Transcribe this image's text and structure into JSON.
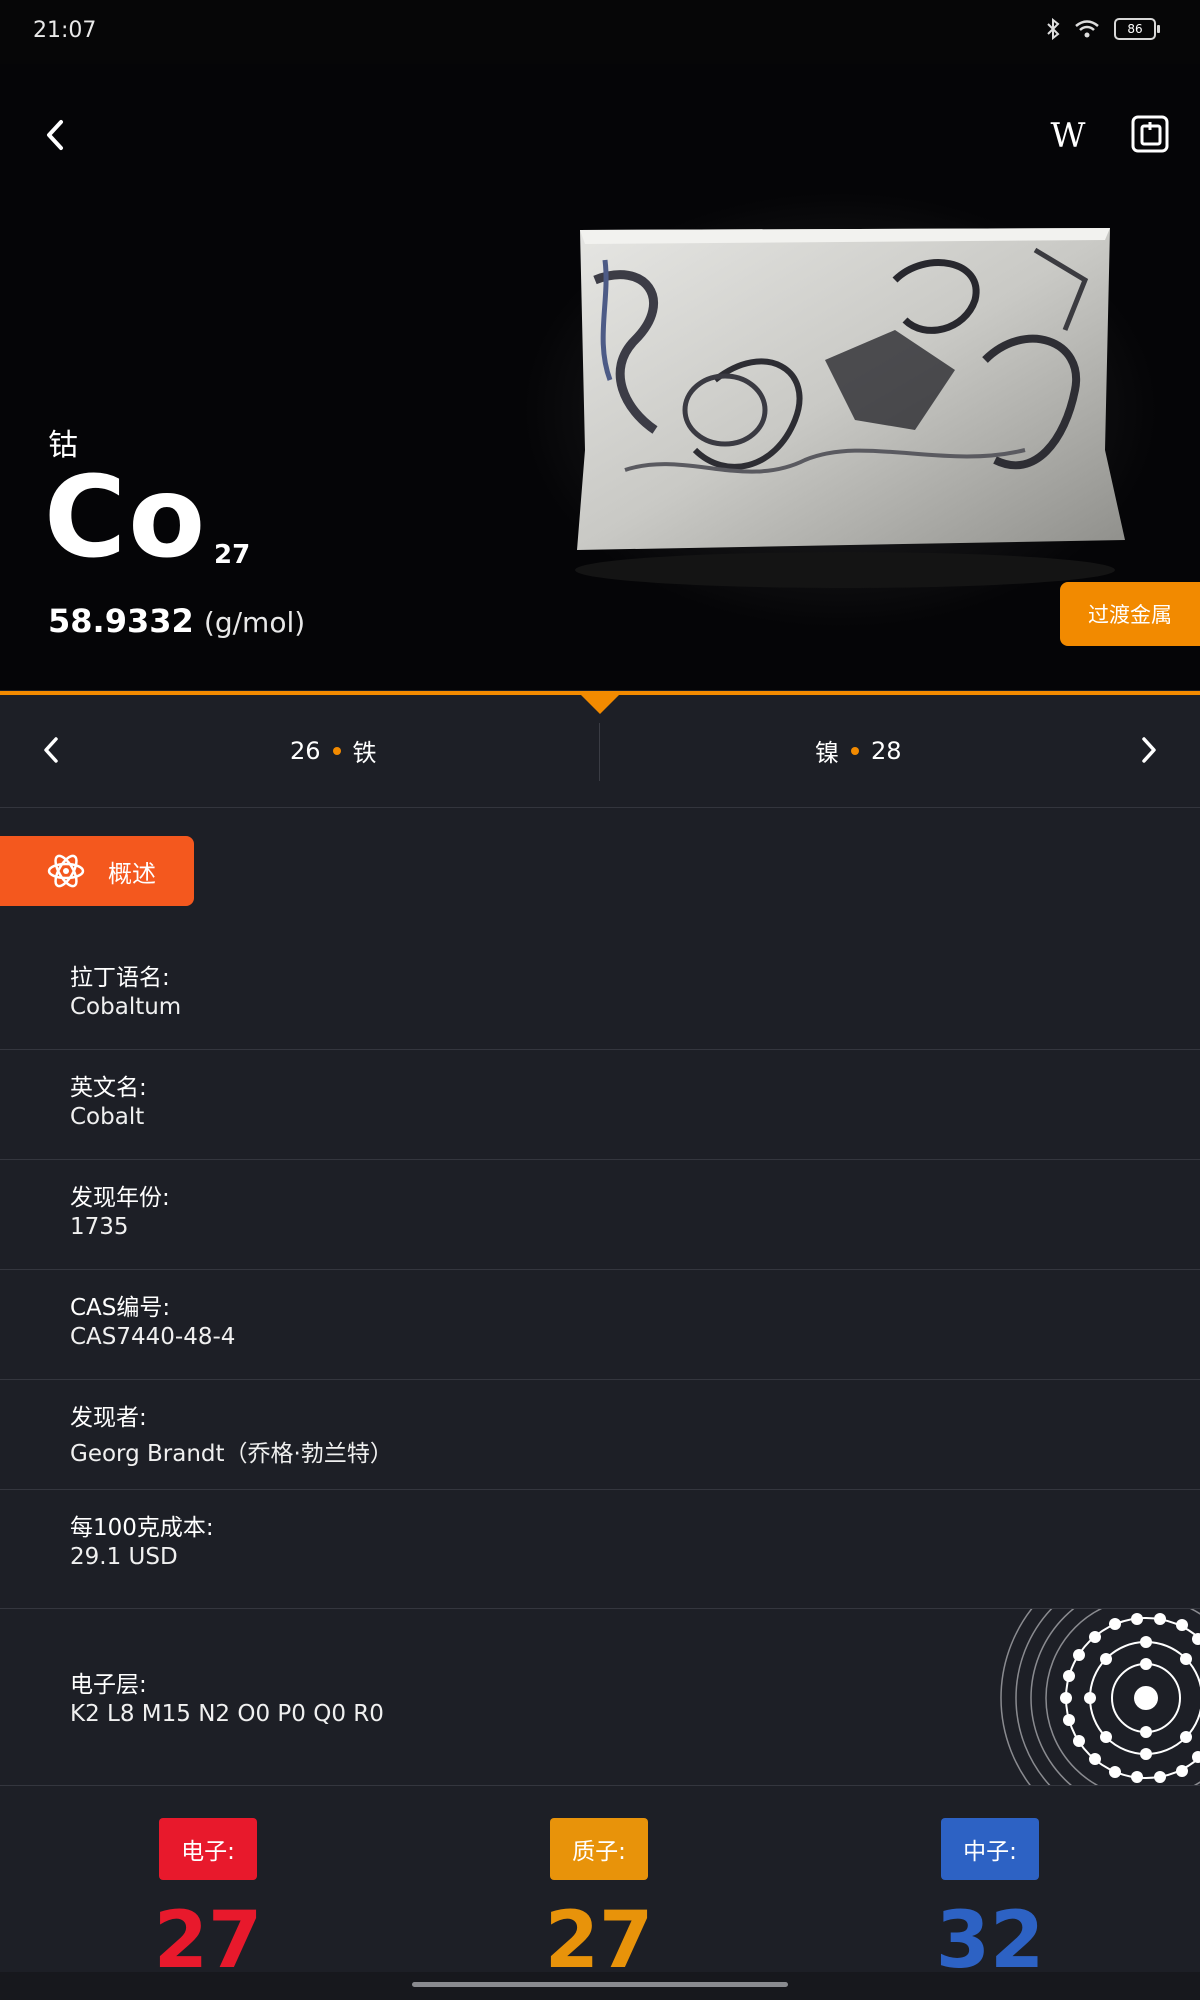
{
  "status_bar": {
    "time": "21:07",
    "battery": "86"
  },
  "header": {
    "wiki_label": "W"
  },
  "element": {
    "name_cn": "钴",
    "symbol": "Co",
    "atomic_number": "27",
    "atomic_mass": "58.9332",
    "mass_unit": "(g/mol)",
    "category": "过渡金属"
  },
  "neighbors": {
    "prev": {
      "number": "26",
      "name": "铁"
    },
    "next": {
      "name": "镍",
      "number": "28"
    }
  },
  "tab": {
    "overview_label": "概述"
  },
  "info": [
    {
      "label": "拉丁语名:",
      "value": "Cobaltum"
    },
    {
      "label": "英文名:",
      "value": "Cobalt"
    },
    {
      "label": "发现年份:",
      "value": "1735"
    },
    {
      "label": "CAS编号:",
      "value": "CAS7440-48-4"
    },
    {
      "label": "发现者:",
      "value": "Georg Brandt（乔格·勃兰特）"
    },
    {
      "label": "每100克成本:",
      "value": "29.1 USD"
    }
  ],
  "electron_shells": {
    "label": "电子层:",
    "value": "K2 L8 M15 N2 O0 P0 Q0 R0"
  },
  "particles": {
    "electrons": {
      "label": "电子:",
      "count": "27",
      "color": "#e8192c"
    },
    "protons": {
      "label": "质子:",
      "count": "27",
      "color": "#e8930a"
    },
    "neutrons": {
      "label": "中子:",
      "count": "32",
      "color": "#2d62c4"
    }
  },
  "colors": {
    "accent": "#f28a00",
    "overview": "#f4581e",
    "background": "#1d1f26"
  }
}
